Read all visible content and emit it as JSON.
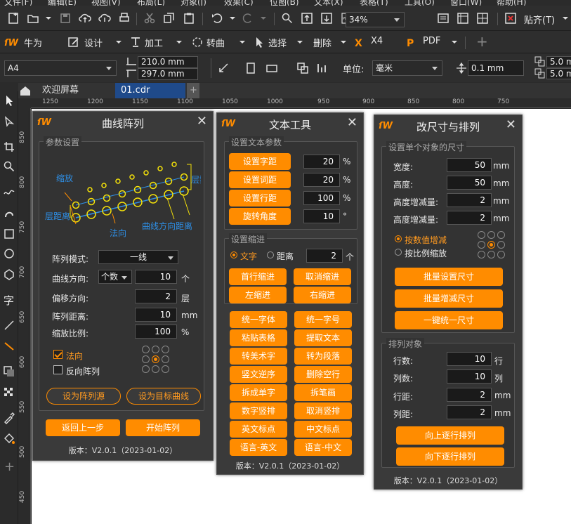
{
  "menu": [
    "文件(F)",
    "编辑(E)",
    "视图(V)",
    "布局(L)",
    "对象(J)",
    "效果(C)",
    "位图(B)",
    "文本(X)",
    "表格(T)",
    "工具(O)",
    "窗口(W)",
    "帮助(H)"
  ],
  "toolbar": {
    "zoom": "34%",
    "snap_label": "贴齐(T)"
  },
  "plugin_bar": {
    "items": [
      "牛为",
      "设计",
      "加工",
      "转曲",
      "选择",
      "删除",
      "X4",
      "PDF"
    ]
  },
  "property_bar": {
    "page_size": "A4",
    "width": "210.0 mm",
    "height": "297.0 mm",
    "unit_label": "单位:",
    "unit": "毫米",
    "nudge": "0.1 mm",
    "dup_x": "5.0 mm",
    "dup_y": "5.0 mm"
  },
  "tabs": {
    "welcome": "欢迎屏幕",
    "doc": "01.cdr"
  },
  "ruler": {
    "h": [
      "1250",
      "1200",
      "1150",
      "1100",
      "1050",
      "1000",
      "950",
      "900",
      "850",
      "800",
      "750"
    ],
    "v": [
      "850",
      "800",
      "750",
      "700",
      "650",
      "600",
      "550",
      "500",
      "450"
    ]
  },
  "curve_panel": {
    "title": "曲线阵列",
    "group": "参数设置",
    "diagram": {
      "scale": "缩放",
      "layers": "层数",
      "layer_dist": "层距离",
      "normal": "法向",
      "curve_dist": "曲线方向距离"
    },
    "mode_label": "阵列模式:",
    "mode_value": "一线",
    "dir_label": "曲线方向:",
    "dir_select": "个数",
    "dir_value": "10",
    "dir_unit": "个",
    "offset_label": "偏移方向:",
    "offset_value": "2",
    "offset_unit": "层",
    "dist_label": "阵列距离:",
    "dist_value": "10",
    "dist_unit": "mm",
    "scale_label": "缩放比例:",
    "scale_value": "100",
    "scale_unit": "%",
    "normal_cb": "法向",
    "reverse_cb": "反向阵列",
    "btn_source": "设为阵列源",
    "btn_target": "设为目标曲线",
    "btn_back": "返回上一步",
    "btn_start": "开始阵列",
    "version": "版本：V2.0.1（2023-01-02）"
  },
  "text_panel": {
    "title": "文本工具",
    "group1": "设置文本参数",
    "rows": [
      {
        "label": "设置字距",
        "value": "20",
        "unit": "%"
      },
      {
        "label": "设置词距",
        "value": "20",
        "unit": "%"
      },
      {
        "label": "设置行距",
        "value": "100",
        "unit": "%"
      },
      {
        "label": "旋转角度",
        "value": "10",
        "unit": "°"
      }
    ],
    "group2": "设置缩进",
    "radio_text": "文字",
    "radio_dist": "距离",
    "indent_value": "2",
    "indent_unit": "个",
    "indent_btns": [
      "首行缩进",
      "取消缩进",
      "左缩进",
      "右缩进"
    ],
    "btns": [
      "统一字体",
      "统一字号",
      "粘贴表格",
      "提取文本",
      "转美术字",
      "转为段落",
      "竖文逆序",
      "删除空行",
      "拆成单字",
      "拆笔画",
      "数字竖排",
      "取消竖排",
      "英文标点",
      "中文标点",
      "语言-英文",
      "语言-中文"
    ],
    "version": "版本：V2.0.1（2023-01-02）"
  },
  "resize_panel": {
    "title": "改尺寸与排列",
    "group1": "设置单个对象的尺寸",
    "rows": [
      {
        "label": "宽度:",
        "value": "50",
        "unit": "mm"
      },
      {
        "label": "高度:",
        "value": "50",
        "unit": "mm"
      },
      {
        "label": "高度增减量:",
        "value": "2",
        "unit": "mm"
      },
      {
        "label": "高度增减量:",
        "value": "2",
        "unit": "mm"
      }
    ],
    "radio1": "按数值增减",
    "radio2": "按比例缩放",
    "btns": [
      "批量设置尺寸",
      "批量增减尺寸",
      "一键统一尺寸"
    ],
    "group2": "排列对象",
    "rows2": [
      {
        "label": "行数:",
        "value": "10",
        "unit": "行"
      },
      {
        "label": "列数:",
        "value": "10",
        "unit": "列"
      },
      {
        "label": "行距:",
        "value": "2",
        "unit": "mm"
      },
      {
        "label": "列距:",
        "value": "2",
        "unit": "mm"
      }
    ],
    "btns2": [
      "向上逐行排列",
      "向下逐行排列"
    ],
    "version": "版本：V2.0.1（2023-01-02）"
  },
  "colors": {
    "accent": "#ff8c00",
    "panel": "#3a3a3a",
    "diagram_blue": "#2e8fe6",
    "diagram_yellow": "#f5e20a"
  }
}
